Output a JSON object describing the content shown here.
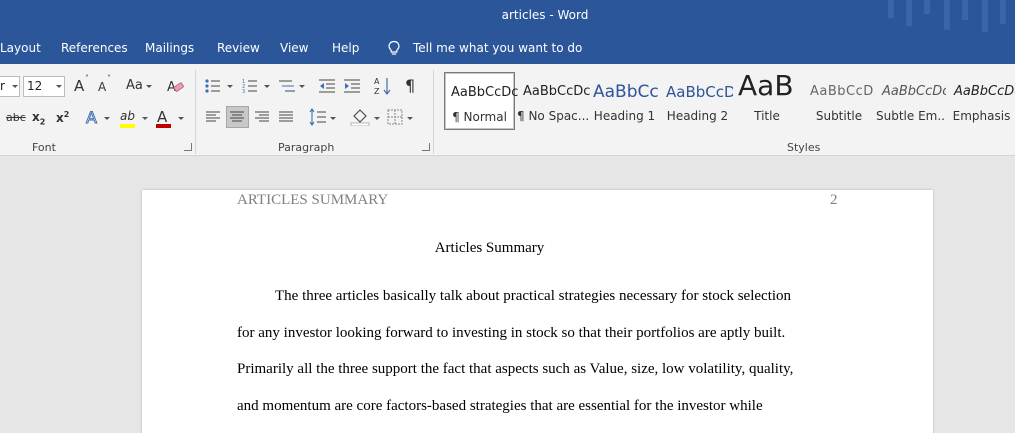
{
  "window": {
    "title": "articles  -  Word"
  },
  "menu": {
    "items": [
      "Layout",
      "References",
      "Mailings",
      "Review",
      "View",
      "Help"
    ],
    "tell_me": "Tell me what you want to do"
  },
  "font_group": {
    "label": "Font",
    "font_name": "r",
    "font_size": "12",
    "grow": "A",
    "shrink": "A",
    "change_case": "Aa",
    "strike": "abc",
    "subscript": "x",
    "superscript": "x",
    "text_effects": "A",
    "highlight": "ab",
    "font_color": "A",
    "font_color_hex": "#c00000",
    "highlight_hex": "#ffff00"
  },
  "paragraph_group": {
    "label": "Paragraph",
    "pilcrow": "¶"
  },
  "styles_group": {
    "label": "Styles",
    "items": [
      {
        "sample": "AaBbCcDc",
        "name": "¶ Normal"
      },
      {
        "sample": "AaBbCcDc",
        "name": "¶ No Spac..."
      },
      {
        "sample": "AaBbCc",
        "name": "Heading 1"
      },
      {
        "sample": "AaBbCcD",
        "name": "Heading 2"
      },
      {
        "sample": "AaB",
        "name": "Title"
      },
      {
        "sample": "AaBbCcD",
        "name": "Subtitle"
      },
      {
        "sample": "AaBbCcDc",
        "name": "Subtle Em..."
      },
      {
        "sample": "AaBbCcDc",
        "name": "Emphasis"
      }
    ]
  },
  "document": {
    "running_head": "ARTICLES SUMMARY",
    "page_number": "2",
    "title": "Articles Summary",
    "lines": [
      "The three articles basically talk about practical strategies necessary for stock selection",
      "for any investor looking forward to investing in stock so that their portfolios are aptly built.",
      "Primarily all the three support the fact that aspects such as Value, size, low volatility, quality,",
      "and momentum are core factors-based strategies that are essential for the investor while"
    ]
  },
  "colors": {
    "ribbon_blue": "#2b579a"
  }
}
